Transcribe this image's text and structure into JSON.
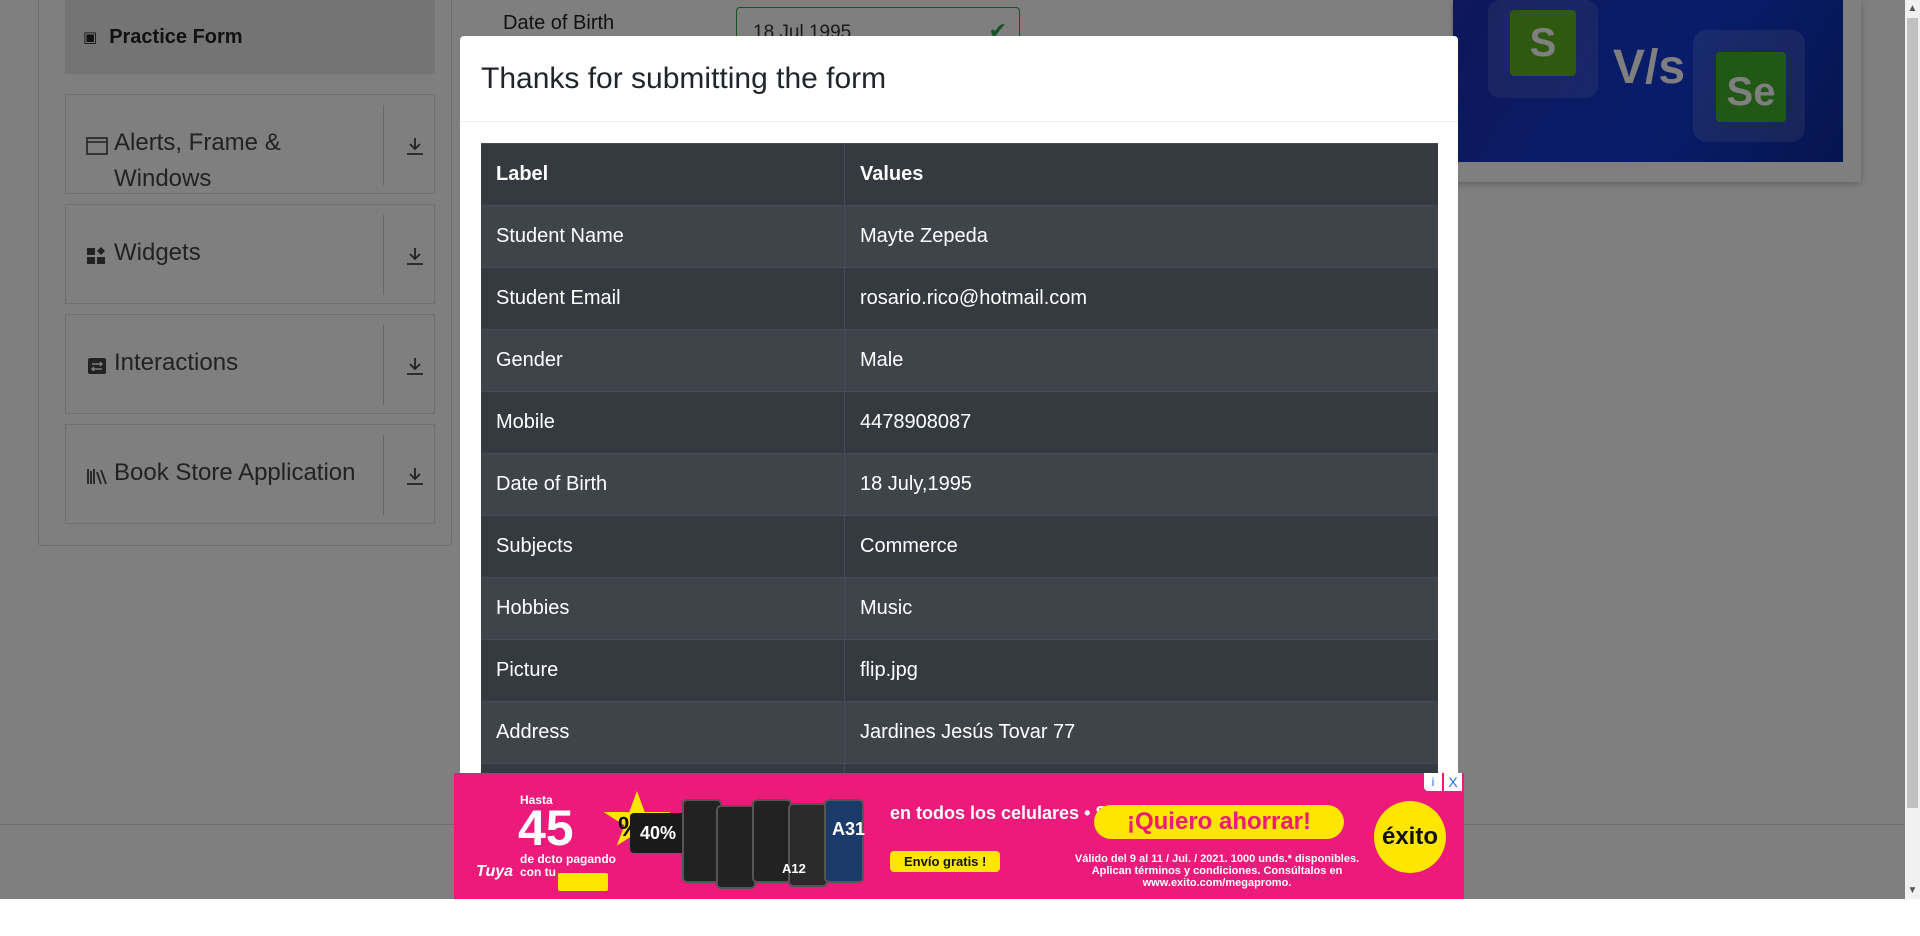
{
  "sidebar": {
    "practice_form": "Practice Form",
    "groups": [
      {
        "label_line1": "Alerts, Frame &",
        "label_line2": "Windows",
        "icon": "window-icon"
      },
      {
        "label_line1": "Widgets",
        "icon": "widgets-icon"
      },
      {
        "label_line1": "Interactions",
        "icon": "interactions-icon"
      },
      {
        "label_line1": "Book Store Application",
        "icon": "books-icon"
      }
    ]
  },
  "form": {
    "dob_label": "Date of Birth",
    "dob_value": "18 Jul 1995"
  },
  "banner": {
    "s": "S",
    "vs": "V/s",
    "se": "Se"
  },
  "modal": {
    "title": "Thanks for submitting the form",
    "header_label": "Label",
    "header_values": "Values",
    "rows": [
      {
        "label": "Student Name",
        "value": "Mayte Zepeda"
      },
      {
        "label": "Student Email",
        "value": "rosario.rico@hotmail.com"
      },
      {
        "label": "Gender",
        "value": "Male"
      },
      {
        "label": "Mobile",
        "value": "4478908087"
      },
      {
        "label": "Date of Birth",
        "value": "18 July,1995"
      },
      {
        "label": "Subjects",
        "value": "Commerce"
      },
      {
        "label": "Hobbies",
        "value": "Music"
      },
      {
        "label": "Picture",
        "value": "flip.jpg"
      },
      {
        "label": "Address",
        "value": "Jardines Jesús Tovar 77"
      }
    ]
  },
  "ad": {
    "brand": "Tuya",
    "hasta": "Hasta",
    "percent": "45",
    "star": "%",
    "extra": "40%",
    "dcto": "de dcto pagando con tu",
    "model1": "A12",
    "model2": "A31",
    "celulares": "en todos los celulares • Samsung.",
    "envio": "Envío gratis  !",
    "cta": "¡Quiero ahorrar!",
    "valido": "Válido del 9 al 11 / Jul. / 2021. 1000 unds.* disponibles. Aplican términos y condiciones. Consúltalos en www.exito.com/megapromo.",
    "logo": "éxito",
    "info": "i",
    "close": "X"
  },
  "colors": {
    "overlay": "#00000080",
    "table_dark": "#343a40",
    "ad_pink": "#ec1a7a",
    "ad_yellow": "#ffe600"
  }
}
